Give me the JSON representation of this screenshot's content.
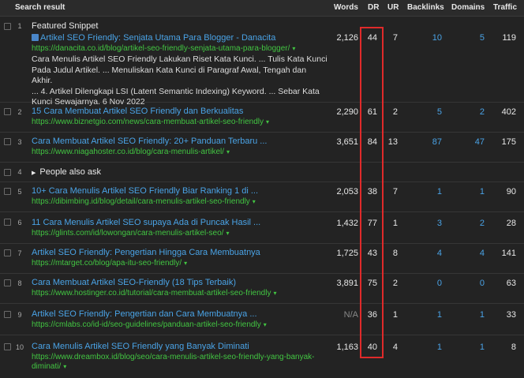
{
  "headers": {
    "search_result": "Search result",
    "words": "Words",
    "dr": "DR",
    "ur": "UR",
    "backlinks": "Backlinks",
    "domains": "Domains",
    "traffic": "Traffic"
  },
  "colors": {
    "link": "#4aa3e6",
    "url": "#42c542",
    "highlight": "#e02a2a",
    "background": "#232323"
  },
  "featured": {
    "num": "1",
    "label": "Featured Snippet",
    "icon": "image-icon",
    "title": "Artikel SEO Friendly: Senjata Utama Para Blogger - Danacita",
    "url": "https://danacita.co.id/blog/artikel-seo-friendly-senjata-utama-para-blogger/",
    "snippet": [
      "Cara Menulis Artikel SEO Friendly Lakukan Riset Kata Kunci. ... Tulis Kata Kunci",
      "Pada Judul Artikel. ... Menuliskan Kata Kunci di Paragraf Awal, Tengah dan Akhir.",
      "... 4. Artikel Dilengkapi LSI (Latent Semantic Indexing) Keyword. ... Sebar Kata",
      "Kunci Sewajarnya. 6 Nov 2022"
    ],
    "words": "2,126",
    "dr": "44",
    "ur": "7",
    "backlinks": "10",
    "domains": "5",
    "traffic": "119"
  },
  "rows": [
    {
      "num": "2",
      "title": "15 Cara Membuat Artikel SEO Friendly dan Berkualitas",
      "url": "https://www.biznetgio.com/news/cara-membuat-artikel-seo-friendly",
      "words": "2,290",
      "dr": "61",
      "ur": "2",
      "backlinks": "5",
      "domains": "2",
      "traffic": "402"
    },
    {
      "num": "3",
      "title": "Cara Membuat Artikel SEO Friendly: 20+ Panduan Terbaru ...",
      "url": "https://www.niagahoster.co.id/blog/cara-menulis-artikel/",
      "words": "3,651",
      "dr": "84",
      "ur": "13",
      "backlinks": "87",
      "domains": "47",
      "traffic": "175"
    },
    {
      "num": "5",
      "title": "10+ Cara Menulis Artikel SEO Friendly Biar Ranking 1 di ...",
      "url": "https://dibimbing.id/blog/detail/cara-menulis-artikel-seo-friendly",
      "words": "2,053",
      "dr": "38",
      "ur": "7",
      "backlinks": "1",
      "domains": "1",
      "traffic": "90"
    },
    {
      "num": "6",
      "title": "11 Cara Menulis Artikel SEO supaya Ada di Puncak Hasil ...",
      "url": "https://glints.com/id/lowongan/cara-menulis-artikel-seo/",
      "words": "1,432",
      "dr": "77",
      "ur": "1",
      "backlinks": "3",
      "domains": "2",
      "traffic": "28"
    },
    {
      "num": "7",
      "title": "Artikel SEO Friendly: Pengertian Hingga Cara Membuatnya",
      "url": "https://mtarget.co/blog/apa-itu-seo-friendly/",
      "words": "1,725",
      "dr": "43",
      "ur": "8",
      "backlinks": "4",
      "domains": "4",
      "traffic": "141"
    },
    {
      "num": "8",
      "title": "Cara Membuat Artikel SEO-Friendly (18 Tips Terbaik)",
      "url": "https://www.hostinger.co.id/tutorial/cara-membuat-artikel-seo-friendly",
      "words": "3,891",
      "dr": "75",
      "ur": "2",
      "backlinks": "0",
      "domains": "0",
      "traffic": "63"
    },
    {
      "num": "9",
      "title": "Artikel SEO Friendly: Pengertian dan Cara Membuatnya ...",
      "url": "https://cmlabs.co/id-id/seo-guidelines/panduan-artikel-seo-friendly",
      "words": "N/A",
      "dr": "36",
      "ur": "1",
      "backlinks": "1",
      "domains": "1",
      "traffic": "33"
    },
    {
      "num": "10",
      "title": "Cara Menulis Artikel SEO Friendly yang Banyak Diminati",
      "url": "https://www.dreambox.id/blog/seo/cara-menulis-artikel-seo-friendly-yang-banyak-",
      "url2": "diminati/",
      "words": "1,163",
      "dr": "40",
      "ur": "4",
      "backlinks": "1",
      "domains": "1",
      "traffic": "8"
    }
  ],
  "paa": {
    "num": "4",
    "label": "People also ask"
  },
  "arrow": "▾",
  "triangle": "▶"
}
